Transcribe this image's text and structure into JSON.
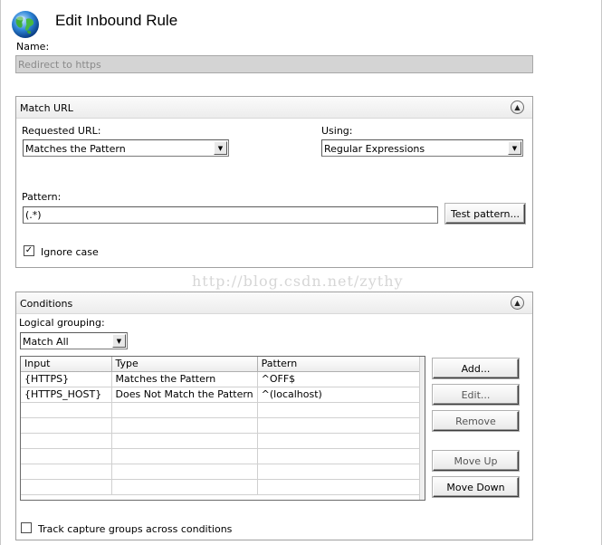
{
  "header": {
    "title": "Edit Inbound Rule",
    "icon": "globe-icon"
  },
  "name_field": {
    "label": "Name:",
    "value": "Redirect to https"
  },
  "match_url": {
    "title": "Match URL",
    "requested_url_label": "Requested URL:",
    "requested_url_value": "Matches the Pattern",
    "using_label": "Using:",
    "using_value": "Regular Expressions",
    "pattern_label": "Pattern:",
    "pattern_value": "(.*)",
    "test_pattern_button": "Test pattern...",
    "ignore_case_label": "Ignore case",
    "ignore_case_checked": true
  },
  "conditions": {
    "title": "Conditions",
    "logical_grouping_label": "Logical grouping:",
    "logical_grouping_value": "Match All",
    "columns": [
      "Input",
      "Type",
      "Pattern"
    ],
    "rows": [
      [
        "{HTTPS}",
        "Matches the Pattern",
        "^OFF$"
      ],
      [
        "{HTTPS_HOST}",
        "Does Not Match the Pattern",
        "^(localhost)"
      ]
    ],
    "buttons": {
      "add": "Add...",
      "edit": "Edit...",
      "remove": "Remove",
      "move_up": "Move Up",
      "move_down": "Move Down"
    },
    "track_capture_label": "Track capture groups across conditions",
    "track_capture_checked": false
  },
  "watermark": "http://blog.csdn.net/zythy",
  "colors": {
    "panel_border": "#a0a0a0",
    "disabled_input": "#d4d4d4"
  }
}
